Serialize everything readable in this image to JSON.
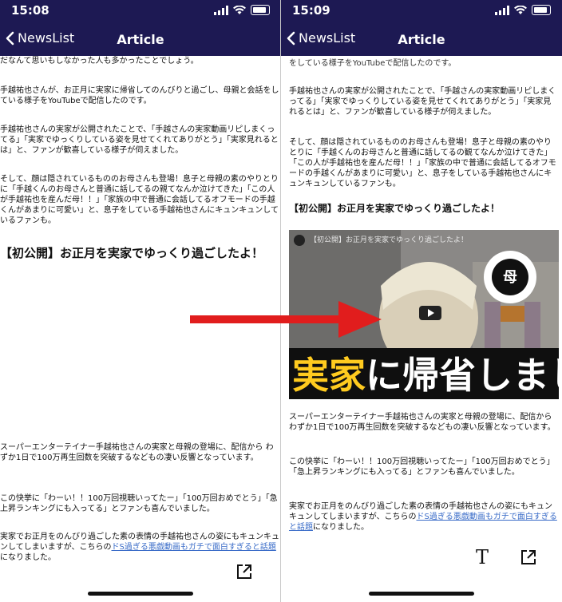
{
  "left": {
    "status_time": "15:08",
    "nav": {
      "back": "NewsList",
      "title": "Article"
    },
    "paragraphs": [
      "だなんて思いもしなかった人も多かったことでしょう。",
      "手越祐也さんが、お正月に実家に帰省してのんびりと過ごし、母親と会話をしている様子をYouTubeで配信したのです。",
      "手越祐也さんの実家が公開されたことで、「手越さんの実家動画リピしまくってる」「実家でゆっくりしている姿を見せてくれてありがとう」「実家見れるとは」と、ファンが歓喜している様子が伺えました。",
      "そして、顔は隠されているもののお母さんも登場！息子と母親の素のやりとりに「手越くんのお母さんと普通に話してるの親てなんか泣けてきた」「この人が手越祐也を産んだ母！！」「家族の中で普通に会話してるオフモードの手越くんがあまりに可愛い」と、息子をしている手越祐也さんにキュンキュンしているファンも。",
      "スーパーエンターテイナー手越祐也さんの実家と母親の登場に、配信から わずか1日で100万再生回数を突破するなどもの凄い反響となっています。",
      "この快挙に「わーい！！100万回視聴いってたー」「100万回おめでとう」「急上昇ランキングにも入ってる」とファンも喜んでいました。"
    ],
    "heading": "【初公開】お正月を実家でゆっくり過ごしたよ！",
    "last_para_before": "実家でお正月をのんびり過ごした素の表情の手越祐也さんの姿にもキュンキュンしてしまいますが、こちらの",
    "last_link": "ドS過ぎる悪戯動画もガチで面白すぎると話題",
    "last_para_after": "になりました。"
  },
  "right": {
    "status_time": "15:09",
    "nav": {
      "back": "NewsList",
      "title": "Article"
    },
    "partial_top": "手越祐也さんが、お正月に実家に帰省してのんびりと過ごし、母親と会話をしている様子をYouTubeで配信したのです。",
    "paragraphs": [
      "手越祐也さんの実家が公開されたことで、「手越さんの実家動画リピしまくってる」「実家でゆっくりしている姿を見せてくれてありがとう」「実家見れるとは」と、ファンが歓喜している様子が伺えました。",
      "そして、顔は隠されているもののお母さんも登場！息子と母親の素のやりとりに「手越くんのお母さんと普通に話してるの観てなんか泣けてきた」「この人が手越祐也を産んだ母！！」「家族の中で普通に会話してるオフモードの手越くんがあまりに可愛い」と、息子をしている手越祐也さんにキュンキュンしているファンも。"
    ],
    "heading": "【初公開】お正月を実家でゆっくり過ごしたよ！",
    "video": {
      "title": "【初公開】お正月を実家でゆっくり過ごしたよ！",
      "caption_yellow": "実家",
      "caption_white": "に帰省しました",
      "badge": "母"
    },
    "after_paragraphs": [
      "スーパーエンターテイナー手越祐也さんの実家と母親の登場に、配信からわずか1日で100万再生回数を突破するなどもの凄い反響となっています。",
      "この快挙に「わーい！！100万回視聴いってたー」「100万回おめでとう」「急上昇ランキングにも入ってる」とファンも喜んでいました。"
    ],
    "last_para_before": "実家でお正月をのんびり過ごした素の表情の手越祐也さんの姿にもキュンキュンしてしまいますが、こちらの",
    "last_link": "ドS過ぎる悪戯動画もガチで面白すぎると話題",
    "last_para_after": "になりました。",
    "toolbar": {
      "text_icon": "T"
    }
  },
  "colors": {
    "nav_bg": "#1d1953",
    "link": "#3a6cc8",
    "arrow": "#e11d1d",
    "caption_yellow": "#ffcb1f"
  }
}
